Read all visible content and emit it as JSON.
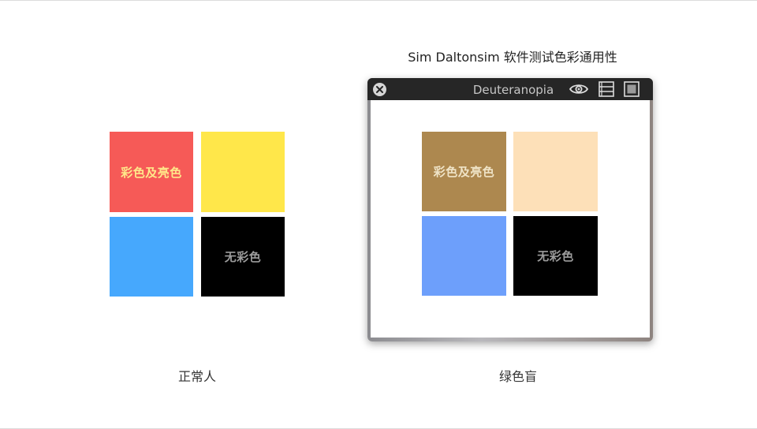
{
  "normal": {
    "caption": "正常人",
    "swatches": [
      {
        "color": "#f65a57",
        "label": "彩色及亮色",
        "label_color": "#ffe88a"
      },
      {
        "color": "#ffe74a",
        "label": "",
        "label_color": "#000000"
      },
      {
        "color": "#46a8fd",
        "label": "",
        "label_color": "#000000"
      },
      {
        "color": "#000000",
        "label": "无彩色",
        "label_color": "#9c9c9c"
      }
    ]
  },
  "simulator": {
    "heading": "Sim Daltonsim 软件测试色彩通用性",
    "window_title": "Deuteranopia",
    "icons": [
      "close-icon",
      "eye-icon",
      "list-icon",
      "square-icon"
    ],
    "caption": "绿色盲",
    "swatches": [
      {
        "color": "#ad884f",
        "label": "彩色及亮色",
        "label_color": "#efe3c6"
      },
      {
        "color": "#fde0b8",
        "label": "",
        "label_color": "#000000"
      },
      {
        "color": "#6d9ffb",
        "label": "",
        "label_color": "#000000"
      },
      {
        "color": "#000000",
        "label": "无彩色",
        "label_color": "#9c9c9c"
      }
    ]
  }
}
